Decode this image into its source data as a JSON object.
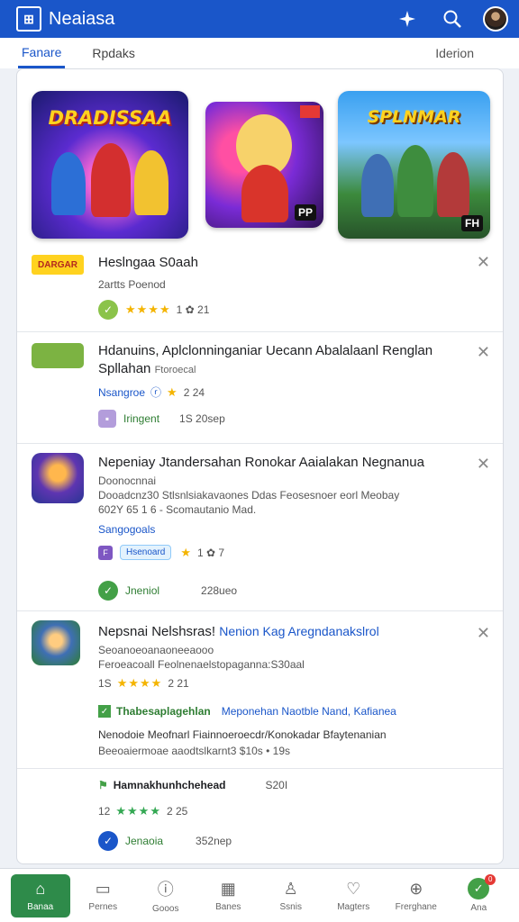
{
  "app": {
    "title": "Neaiasa"
  },
  "tabs": {
    "items": [
      "Fanare",
      "Rpdaks"
    ],
    "right": "Iderion"
  },
  "banners": [
    {
      "title": "DRADISSAA",
      "badge": ""
    },
    {
      "title": "",
      "badge": "PP"
    },
    {
      "title": "SPLNMAR",
      "badge": "FH"
    }
  ],
  "items": [
    {
      "title": "Heslngaa S0aah",
      "subtitle": "2artts Poenod",
      "icon_label": "DARGAR",
      "rating_text": "1 ✿ 21",
      "stars": "★★★★"
    },
    {
      "title": "Hdanuins, Aplclonninganiar Uecann Abalalaanl Renglan",
      "title2": "Spllahan",
      "title2_suffix": "Ftoroecal",
      "link": "Nsangroe",
      "rating_text": "2 24",
      "chip": "Iringent",
      "chip_meta": "1S 20sep"
    },
    {
      "title": "Nepeniay Jtandersahan Ronokar Aaialakan Negnanua",
      "desc1": "Doonocnnai",
      "desc2": "Dooadcnz30 Stlsnlsiakavaones Ddas Feosesnoer eorl Meobay",
      "desc3": "602Y 65 1 6 - Scomautanio Mad.",
      "link": "Sangogoals",
      "chip": "Hsenoard",
      "rating_text": "1 ✿ 7",
      "status": "Jneniol",
      "status_meta": "228ueo"
    },
    {
      "title": "Nepsnai Nelshsras!",
      "title_link": "Nenion Kag Aregndanakslrol",
      "desc1": "Seoanoeoanaoneeaooo",
      "desc2": "Feroeacoall Feolnenaelstopaganna:S30aal",
      "rating_prefix": "1S",
      "stars": "★★★★",
      "rating_text": "2 21",
      "sub_title": "Thabesaplagehlan",
      "sub_link": "Meponehan Naotble Nand, Kafianea",
      "desc3": "Nenodoie Meofnarl Fiainnoeroecdr/Konokadar Bfaytenanian",
      "desc4": "Beeoaiermoae aaodtslkarnt3 $10s • 19s",
      "sub_title2": "Hamnakhunhchehead",
      "sub_meta": "S20I",
      "rating_prefix2": "12",
      "rating_text2": "2 25",
      "status": "Jenaoia",
      "status_meta": "352nep"
    }
  ],
  "nav": [
    {
      "label": "Banaa",
      "icon": "home-icon"
    },
    {
      "label": "Pernes",
      "icon": "card-icon"
    },
    {
      "label": "Gooos",
      "icon": "info-icon"
    },
    {
      "label": "Banes",
      "icon": "grid-icon"
    },
    {
      "label": "Ssnis",
      "icon": "person-icon"
    },
    {
      "label": "Magters",
      "icon": "heart-icon"
    },
    {
      "label": "Frerghane",
      "icon": "share-icon"
    },
    {
      "label": "Ana",
      "icon": "profile-icon",
      "badge": "0"
    }
  ],
  "colors": {
    "primary": "#1a56c9",
    "active_nav": "#2e8b4a",
    "star": "#f4b400"
  }
}
